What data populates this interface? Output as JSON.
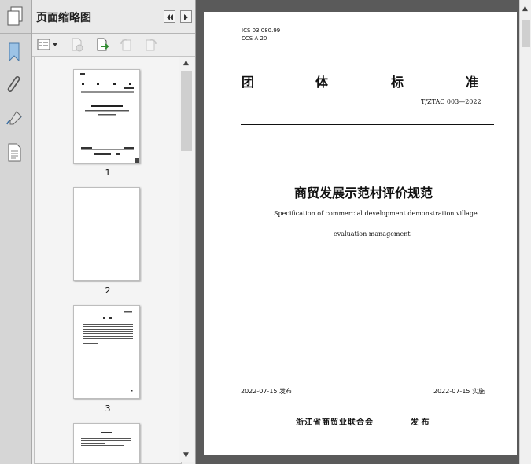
{
  "panel": {
    "title": "页面缩略图",
    "thumbnails": [
      {
        "label": "1"
      },
      {
        "label": "2"
      },
      {
        "label": "3"
      }
    ]
  },
  "document": {
    "ics_line1": "ICS 03.080.99",
    "ics_line2": "CCS A 20",
    "standard_type": [
      "团",
      "体",
      "标",
      "准"
    ],
    "standard_number": "T/ZTAC 003—2022",
    "title_cn": "商贸发展示范村评价规范",
    "title_en_line1": "Specification of commercial development demonstration village",
    "title_en_line2": "evaluation management",
    "issue_date": "2022-07-15 发布",
    "effective_date": "2022-07-15 实施",
    "publisher": "浙江省商贸业联合会",
    "publish_word": "发 布"
  },
  "colors": {
    "viewer_bg": "#5a5a5a",
    "panel_bg": "#efefef"
  }
}
